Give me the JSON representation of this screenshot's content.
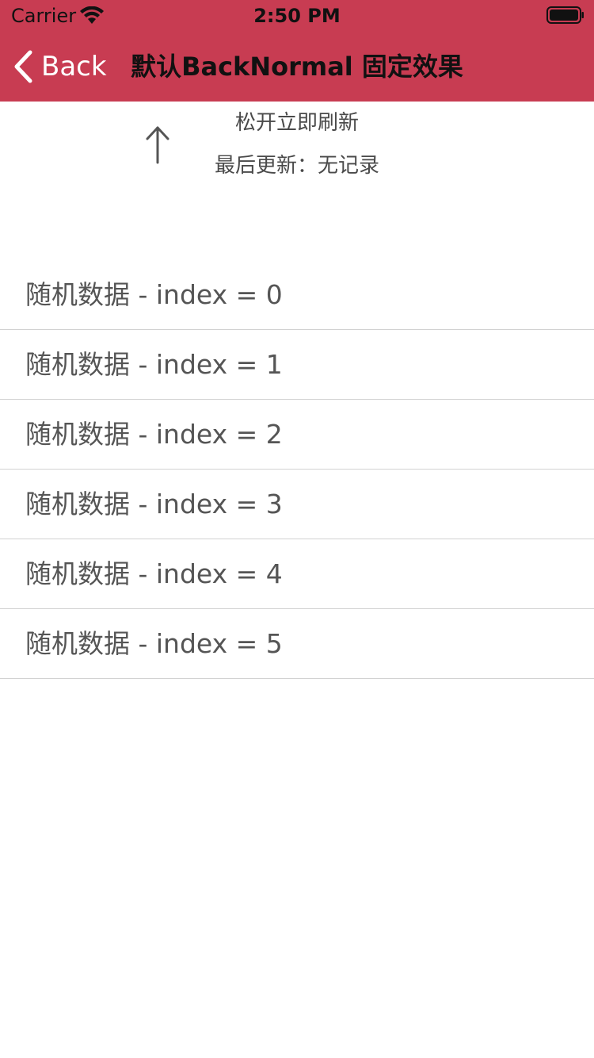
{
  "status_bar": {
    "carrier": "Carrier",
    "time": "2:50 PM"
  },
  "nav": {
    "back_label": "Back",
    "title": "默认BackNormal 固定效果"
  },
  "refresh": {
    "status_text": "松开立即刷新",
    "updated_text": "最后更新：无记录"
  },
  "list": {
    "items": [
      "随机数据 - index = 0",
      "随机数据 - index = 1",
      "随机数据 - index = 2",
      "随机数据 - index = 3",
      "随机数据 - index = 4",
      "随机数据 - index = 5"
    ]
  },
  "colors": {
    "nav_background": "#c83c52",
    "text": "#555555"
  }
}
